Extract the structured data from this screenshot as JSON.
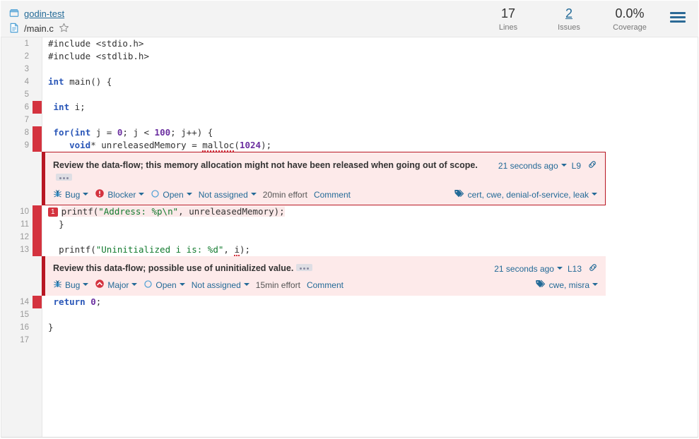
{
  "header": {
    "project": "godin-test",
    "file": "/main.c",
    "project_icon": "folder-icon",
    "file_icon": "file-icon",
    "favorite_icon": "star-icon",
    "menu_icon": "hamburger-icon",
    "metrics": [
      {
        "value": "17",
        "label": "Lines",
        "is_link": false
      },
      {
        "value": "2",
        "label": "Issues",
        "is_link": true
      },
      {
        "value": "0.0%",
        "label": "Coverage",
        "is_link": false
      }
    ]
  },
  "colors": {
    "issue_marker": "#d4333f",
    "issue_border": "#b81723",
    "issue_bg": "#fdeaea",
    "link": "#236a97",
    "header_bg": "#f3f3f3",
    "keyword": "#2a57b8",
    "string": "#127a2e",
    "number": "#6b2fa0"
  },
  "code": {
    "lines": [
      {
        "n": "1",
        "marker": false
      },
      {
        "n": "2",
        "marker": false
      },
      {
        "n": "3",
        "marker": false
      },
      {
        "n": "4",
        "marker": false
      },
      {
        "n": "5",
        "marker": false
      },
      {
        "n": "6",
        "marker": true
      },
      {
        "n": "7",
        "marker": false
      },
      {
        "n": "8",
        "marker": true
      },
      {
        "n": "9",
        "marker": true
      },
      {
        "n": "10",
        "marker": true,
        "badge": "1"
      },
      {
        "n": "11",
        "marker": true
      },
      {
        "n": "12",
        "marker": true
      },
      {
        "n": "13",
        "marker": true
      },
      {
        "n": "14",
        "marker": true
      },
      {
        "n": "15",
        "marker": false
      },
      {
        "n": "16",
        "marker": false
      },
      {
        "n": "17",
        "marker": false
      }
    ],
    "text": {
      "l1": "#include <stdio.h>",
      "l2": "#include <stdlib.h>",
      "l3": "",
      "l4_kw": "int",
      "l4_rest": " main() {",
      "l5": "",
      "l6_kw": "int",
      "l6_rest": " i;",
      "l7": "",
      "l8_a": "for(",
      "l8_kw": "int",
      "l8_b": " j = ",
      "l8_n0": "0",
      "l8_c": "; j < ",
      "l8_n1": "100",
      "l8_d": "; j++) {",
      "l9_kw": "void",
      "l9_a": "* unreleasedMemory = ",
      "l9_fn": "malloc",
      "l9_b": "(",
      "l9_n": "1024",
      "l9_c": ");",
      "l10_a": "printf(",
      "l10_str": "\"Address: %p\\n\"",
      "l10_b": ", unreleasedMemory);",
      "l11": "}",
      "l12": "",
      "l13_a": "printf(",
      "l13_str": "\"Uninitialized i is: %d\"",
      "l13_b": ", ",
      "l13_var": "i",
      "l13_c": ");",
      "l14_kw": "return",
      "l14_sp": " ",
      "l14_n": "0",
      "l14_end": ";",
      "l15": "",
      "l16": "}",
      "l17": ""
    }
  },
  "issues": [
    {
      "message": "Review the data-flow; this memory allocation might not have been released when going out of scope.",
      "expand_icon": "ellipsis-icon",
      "date": "21 seconds ago",
      "line_ref": "L9",
      "permalink_icon": "link-icon",
      "type_icon": "bug-icon",
      "type": "Bug",
      "severity_icon": "blocker-icon",
      "severity": "Blocker",
      "status_icon": "open-circle-icon",
      "status": "Open",
      "assignee": "Not assigned",
      "effort": "20min effort",
      "comment": "Comment",
      "tags_icon": "tag-icon",
      "tags": "cert, cwe, denial-of-service, leak"
    },
    {
      "message": "Review this data-flow; possible use of uninitialized value.",
      "expand_icon": "ellipsis-icon",
      "date": "21 seconds ago",
      "line_ref": "L13",
      "permalink_icon": "link-icon",
      "type_icon": "bug-icon",
      "type": "Bug",
      "severity_icon": "major-icon",
      "severity": "Major",
      "status_icon": "open-circle-icon",
      "status": "Open",
      "assignee": "Not assigned",
      "effort": "15min effort",
      "comment": "Comment",
      "tags_icon": "tag-icon",
      "tags": "cwe, misra"
    }
  ]
}
